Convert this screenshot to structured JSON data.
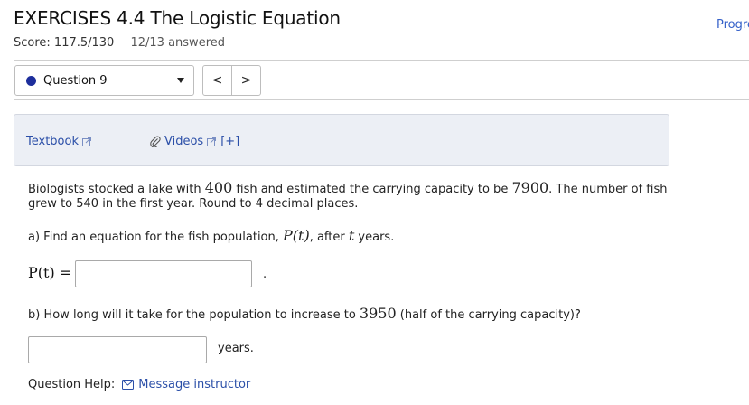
{
  "header": {
    "title": "EXERCISES 4.4 The Logistic Equation",
    "progress_link": "Progre",
    "score": "Score: 117.5/130",
    "answered": "12/13 answered"
  },
  "question_nav": {
    "selected": "Question 9",
    "prev_label": "<",
    "next_label": ">",
    "status_color": "#1d2e9c"
  },
  "help_box": {
    "textbook": "Textbook",
    "videos": "Videos",
    "more": "[+]"
  },
  "problem": {
    "text_1": "Biologists stocked a lake with ",
    "initial": "400",
    "text_2": " fish and estimated the carrying capacity to be ",
    "capacity": "7900",
    "text_3": ". The number of fish grew to 540 in the first year. Round to 4 decimal places.",
    "part_a_prefix": "a) Find an equation for the fish population, ",
    "part_a_func": "P(t)",
    "part_a_mid": ", after ",
    "part_a_var": "t",
    "part_a_suffix": " years.",
    "answer_a_lhs": "P(t) =",
    "answer_a_value": "",
    "answer_a_period": ".",
    "part_b_prefix": "b) How long will it take for the population to increase to ",
    "part_b_value": "3950",
    "part_b_suffix": " (half of the carrying capacity)?",
    "answer_b_value": "",
    "answer_b_unit": "years."
  },
  "question_help": {
    "label": "Question Help:",
    "message": "Message instructor"
  }
}
